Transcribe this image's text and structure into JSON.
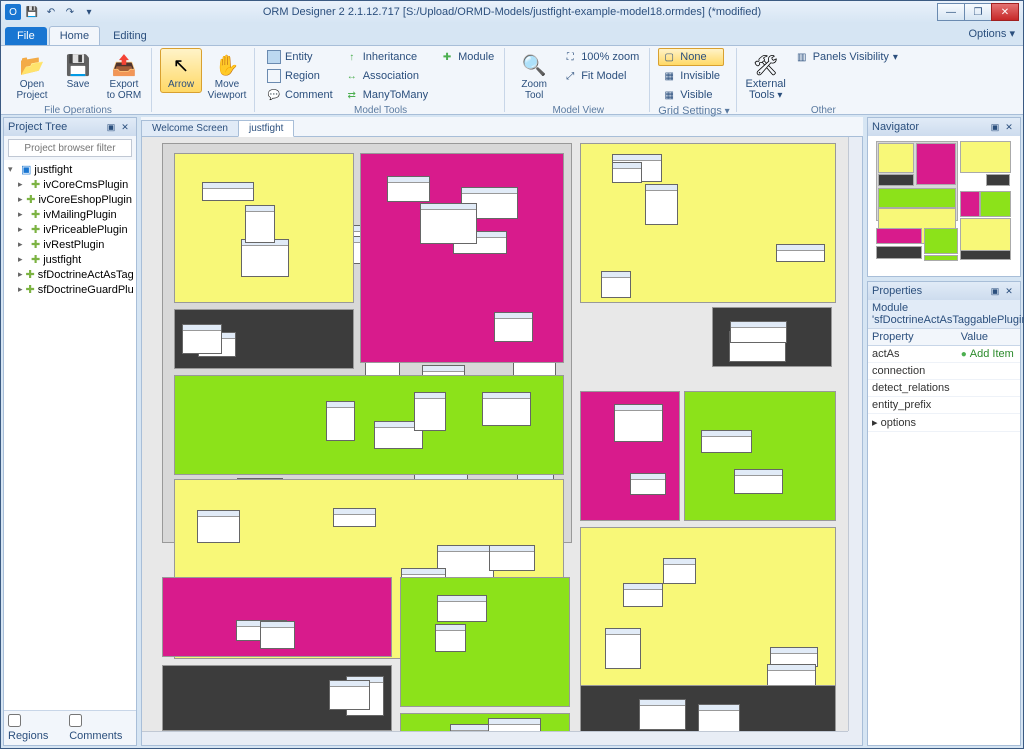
{
  "title": "ORM Designer 2 2.1.12.717 [S:/Upload/ORMD-Models/justfight-example-model18.ormdes] (*modified)",
  "options_label": "Options",
  "tabs": {
    "file": "File",
    "home": "Home",
    "editing": "Editing"
  },
  "ribbon": {
    "file_ops": {
      "label": "File Operations",
      "open": "Open Project",
      "save": "Save",
      "export": "Export to ORM"
    },
    "nav": {
      "arrow": "Arrow",
      "move": "Move Viewport"
    },
    "model_tools": {
      "label": "Model Tools",
      "entity": "Entity",
      "region": "Region",
      "comment": "Comment",
      "inheritance": "Inheritance",
      "association": "Association",
      "many": "ManyToMany",
      "module": "Module"
    },
    "model_view": {
      "label": "Model View",
      "zoom": "Zoom Tool",
      "zoom100": "100% zoom",
      "fit": "Fit Model"
    },
    "grid": {
      "label": "Grid Settings",
      "none": "None",
      "invisible": "Invisible",
      "visible": "Visible"
    },
    "other": {
      "label": "Other",
      "external": "External Tools",
      "panels": "Panels Visibility"
    }
  },
  "project_tree": {
    "title": "Project Tree",
    "filter_placeholder": "Project browser filter",
    "root": "justfight",
    "items": [
      "ivCoreCmsPlugin",
      "ivCoreEshopPlugin",
      "ivMailingPlugin",
      "ivPriceablePlugin",
      "ivRestPlugin",
      "justfight",
      "sfDoctrineActAsTagg...",
      "sfDoctrineGuardPlugin"
    ],
    "footer": {
      "regions": "Regions",
      "comments": "Comments"
    }
  },
  "doc_tabs": {
    "welcome": "Welcome Screen",
    "model": "justfight"
  },
  "navigator": {
    "title": "Navigator"
  },
  "properties": {
    "title": "Properties",
    "module": "Module 'sfDoctrineActAsTaggablePlugin'",
    "cols": {
      "property": "Property",
      "value": "Value"
    },
    "rows": [
      {
        "k": "actAs",
        "v": "Add Item",
        "add": true
      },
      {
        "k": "connection",
        "v": ""
      },
      {
        "k": "detect_relations",
        "v": ""
      },
      {
        "k": "entity_prefix",
        "v": ""
      },
      {
        "k": "options",
        "v": "",
        "exp": true
      }
    ]
  },
  "colors": {
    "yellow": "#f8f878",
    "magenta": "#d81b8c",
    "green": "#8ce21a",
    "dark": "#3c3c3c",
    "grey": "#d8d8d8"
  }
}
